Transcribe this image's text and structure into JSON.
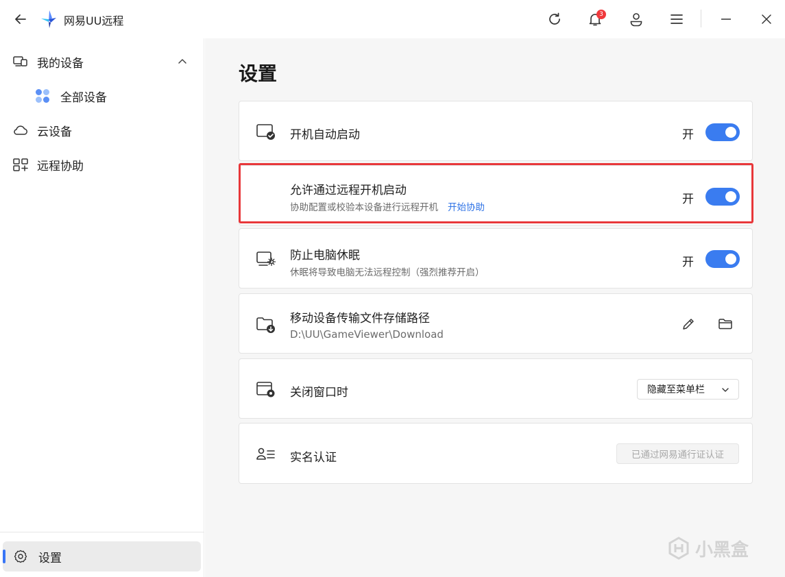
{
  "app": {
    "title": "网易UU远程",
    "notification_count": "3"
  },
  "sidebar": {
    "items": [
      {
        "label": "我的设备",
        "icon": "devices-icon"
      },
      {
        "label": "全部设备",
        "icon": "grid-icon"
      },
      {
        "label": "云设备",
        "icon": "cloud-icon"
      },
      {
        "label": "远程协助",
        "icon": "assist-icon"
      }
    ],
    "settings_label": "设置"
  },
  "main": {
    "title": "设置",
    "settings": [
      {
        "title": "开机自动启动",
        "state": "开",
        "enabled": true
      },
      {
        "title": "允许通过远程开机启动",
        "subtitle": "协助配置或校验本设备进行远程开机",
        "link": "开始协助",
        "state": "开",
        "enabled": true
      },
      {
        "title": "防止电脑休眠",
        "subtitle": "休眠将导致电脑无法远程控制（强烈推荐开启）",
        "state": "开",
        "enabled": true
      },
      {
        "title": "移动设备传输文件存储路径",
        "subtitle": "D:\\UU\\GameViewer\\Download"
      },
      {
        "title": "关闭窗口时",
        "select_value": "隐藏至菜单栏"
      },
      {
        "title": "实名认证",
        "status": "已通过网易通行证认证"
      }
    ]
  },
  "watermark": "小黑盒",
  "colors": {
    "accent": "#3a7cf0",
    "highlight": "#e8373a",
    "link": "#2f73e6"
  }
}
